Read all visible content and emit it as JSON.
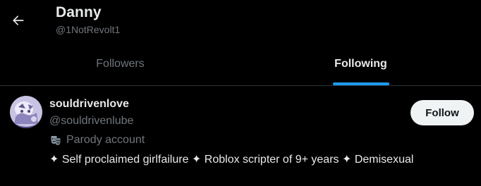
{
  "header": {
    "name": "Danny",
    "handle": "@1NotRevolt1",
    "back_icon": "arrow-left-icon"
  },
  "tabs": [
    {
      "label": "Followers",
      "active": false
    },
    {
      "label": "Following",
      "active": true
    }
  ],
  "colors": {
    "background": "#000000",
    "accent": "#1d9bf0",
    "primary_text": "#e7e9ea",
    "secondary_text": "#71767b",
    "divider": "#2f3336",
    "follow_button_bg": "#eff3f4",
    "follow_button_text": "#0f1419"
  },
  "users": [
    {
      "display_name": "souldrivenlove",
      "handle": "@souldrivenlube",
      "badge_icon": "theater-masks-icon",
      "badge_label": "Parody account",
      "bio": "✦ Self proclaimed girlfailure ✦ Roblox scripter of 9+ years ✦ Demisexual",
      "follow_label": "Follow",
      "avatar_icon": "avatar-image"
    }
  ]
}
